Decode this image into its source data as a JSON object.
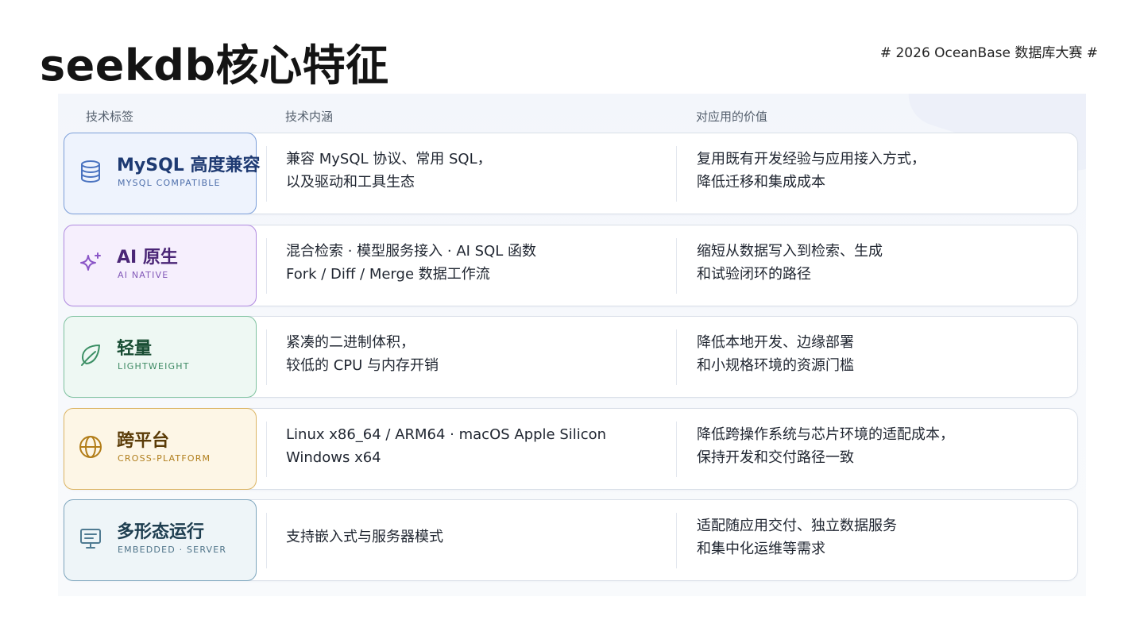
{
  "header": {
    "title": "seekdb核心特征",
    "event_tag": "# 2026 OceanBase 数据库大赛 #"
  },
  "columns": {
    "tag": "技术标签",
    "meaning": "技术内涵",
    "value": "对应用的价值"
  },
  "rows": [
    {
      "title": "MySQL 高度兼容",
      "subtitle": "MYSQL COMPATIBLE",
      "icon": "database-icon",
      "meaning": [
        "兼容 MySQL 协议、常用 SQL，",
        "以及驱动和工具生态"
      ],
      "value": [
        "复用既有开发经验与应用接入方式，",
        "降低迁移和集成成本"
      ],
      "colors": {
        "bg": "#eef3fd",
        "border": "#7c9fd9",
        "title": "#1e3a72",
        "sub": "#4e6fab",
        "icon": "#4a73c0"
      }
    },
    {
      "title": "AI 原生",
      "subtitle": "AI NATIVE",
      "icon": "sparkle-icon",
      "meaning": [
        "混合检索 · 模型服务接入 · AI SQL 函数",
        "Fork / Diff / Merge 数据工作流"
      ],
      "value": [
        "缩短从数据写入到检索、生成",
        "和试验闭环的路径"
      ],
      "colors": {
        "bg": "#f6effd",
        "border": "#b08ae0",
        "title": "#4a2576",
        "sub": "#8258b8",
        "icon": "#8a55c7"
      }
    },
    {
      "title": "轻量",
      "subtitle": "LIGHTWEIGHT",
      "icon": "leaf-icon",
      "meaning": [
        "紧凑的二进制体积，",
        "较低的 CPU 与内存开销"
      ],
      "value": [
        "降低本地开发、边缘部署",
        "和小规格环境的资源门槛"
      ],
      "colors": {
        "bg": "#eef8f3",
        "border": "#7fc2a0",
        "title": "#184d33",
        "sub": "#3e8a64",
        "icon": "#3b8f64"
      }
    },
    {
      "title": "跨平台",
      "subtitle": "CROSS-PLATFORM",
      "icon": "globe-icon",
      "meaning": [
        "Linux x86_64 / ARM64 · macOS Apple Silicon",
        "Windows x64"
      ],
      "value": [
        "降低跨操作系统与芯片环境的适配成本，",
        "保持开发和交付路径一致"
      ],
      "colors": {
        "bg": "#fdf6e6",
        "border": "#dcb564",
        "title": "#5a3b07",
        "sub": "#b07e1c",
        "icon": "#b27d18"
      }
    },
    {
      "title": "多形态运行",
      "subtitle": "EMBEDDED · SERVER",
      "icon": "monitor-icon",
      "meaning": [
        "支持嵌入式与服务器模式"
      ],
      "value": [
        "适配随应用交付、独立数据服务",
        "和集中化运维等需求"
      ],
      "colors": {
        "bg": "#eef5f8",
        "border": "#7ea6bd",
        "title": "#1d3d4f",
        "sub": "#4f7489",
        "icon": "#4f7b92"
      }
    }
  ]
}
